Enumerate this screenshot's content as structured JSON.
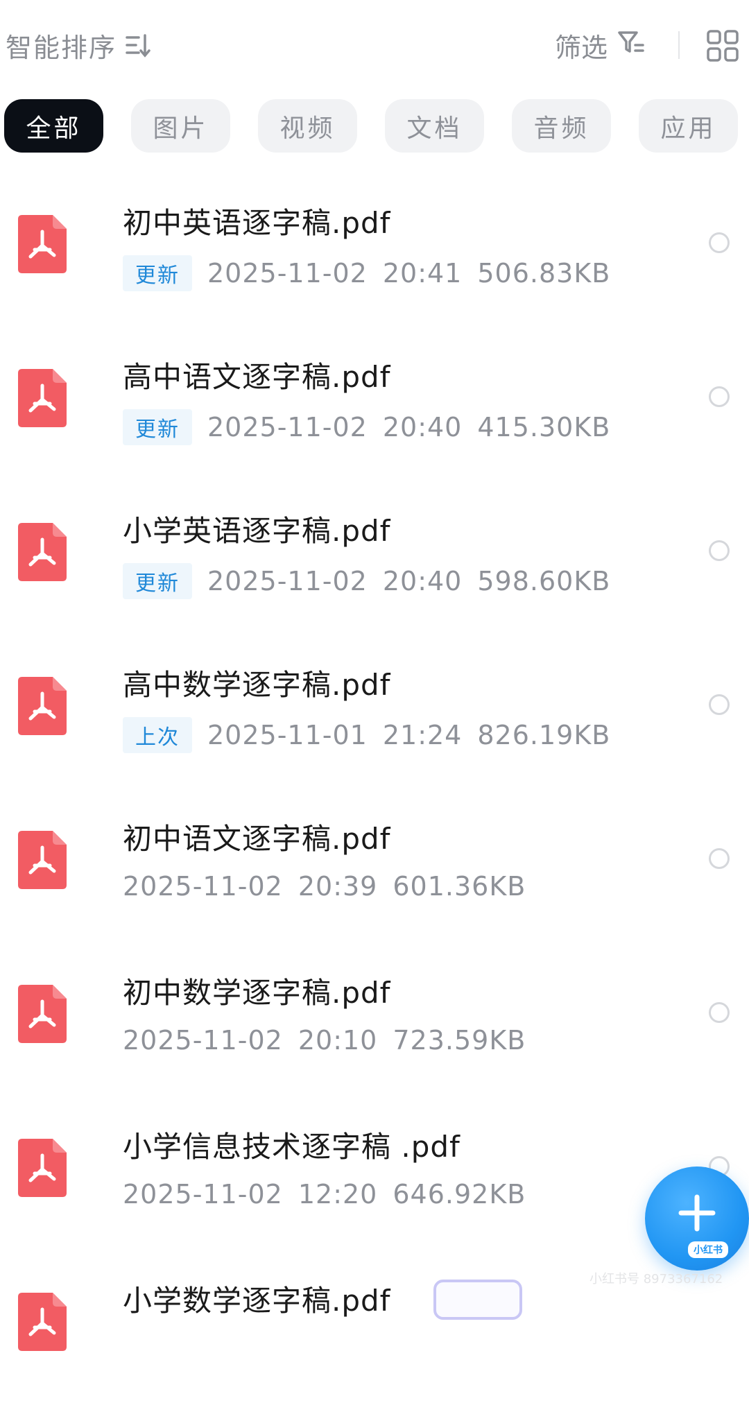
{
  "toolbar": {
    "sort_label": "智能排序",
    "filter_label": "筛选"
  },
  "tabs": [
    {
      "label": "全部",
      "active": true
    },
    {
      "label": "图片",
      "active": false
    },
    {
      "label": "视频",
      "active": false
    },
    {
      "label": "文档",
      "active": false
    },
    {
      "label": "音频",
      "active": false
    },
    {
      "label": "应用",
      "active": false
    }
  ],
  "files": [
    {
      "name": "初中英语逐字稿.pdf",
      "badge": "更新",
      "date": "2025-11-02",
      "time": "20:41",
      "size": "506.83KB"
    },
    {
      "name": "高中语文逐字稿.pdf",
      "badge": "更新",
      "date": "2025-11-02",
      "time": "20:40",
      "size": "415.30KB"
    },
    {
      "name": "小学英语逐字稿.pdf",
      "badge": "更新",
      "date": "2025-11-02",
      "time": "20:40",
      "size": "598.60KB"
    },
    {
      "name": "高中数学逐字稿.pdf",
      "badge": "上次",
      "date": "2025-11-01",
      "time": "21:24",
      "size": "826.19KB"
    },
    {
      "name": "初中语文逐字稿.pdf",
      "badge": "",
      "date": "2025-11-02",
      "time": "20:39",
      "size": "601.36KB"
    },
    {
      "name": "初中数学逐字稿.pdf",
      "badge": "",
      "date": "2025-11-02",
      "time": "20:10",
      "size": "723.59KB"
    },
    {
      "name": "小学信息技术逐字稿 .pdf",
      "badge": "",
      "date": "2025-11-02",
      "time": "12:20",
      "size": "646.92KB"
    },
    {
      "name": "小学数学逐字稿.pdf",
      "badge": "",
      "date": "",
      "time": "",
      "size": ""
    }
  ],
  "fab": {
    "badge": "小红书"
  },
  "watermark": "小红书号 8973367162",
  "colors": {
    "accent_blue": "#2196f3",
    "pdf_red": "#f25c63",
    "active_tab": "#0b0f16",
    "badge_blue": "#1f88d8"
  }
}
